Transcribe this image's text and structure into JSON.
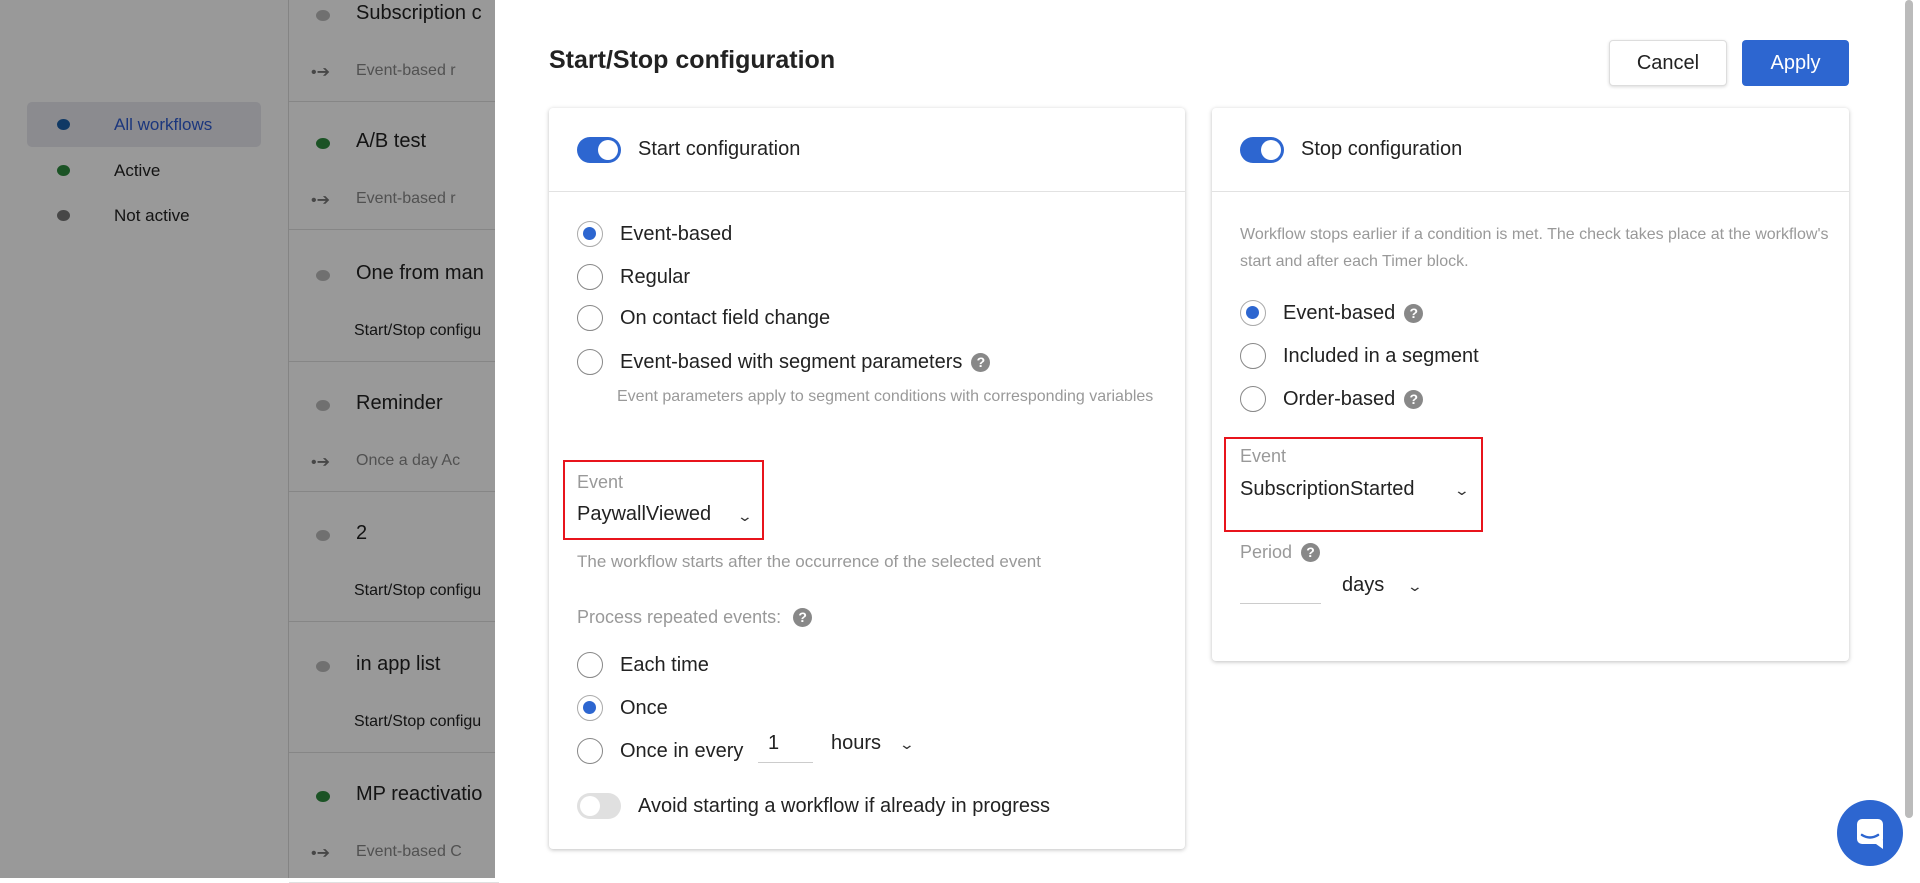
{
  "sidebar": {
    "items": [
      {
        "label": "All workflows",
        "color": "#1b5fa8",
        "selected": true
      },
      {
        "label": "Active",
        "color": "#2e8b3e"
      },
      {
        "label": "Not active",
        "color": "#777777"
      }
    ]
  },
  "workflows": [
    {
      "title": "Subscription c",
      "sub": "Event-based r",
      "trigger": true,
      "color": "#bbbbbb"
    },
    {
      "title": "A/B test",
      "sub": "Event-based r",
      "trigger": true,
      "color": "#2e8b3e"
    },
    {
      "title": "One from man",
      "sub": "Start/Stop configu",
      "trigger": false,
      "color": "#bbbbbb"
    },
    {
      "title": "Reminder",
      "sub": "Once a day  Ac",
      "trigger": true,
      "color": "#bbbbbb"
    },
    {
      "title": "2",
      "sub": "Start/Stop configu",
      "trigger": false,
      "color": "#bbbbbb"
    },
    {
      "title": "in app list",
      "sub": "Start/Stop configu",
      "trigger": false,
      "color": "#bbbbbb"
    },
    {
      "title": "MP reactivatio",
      "sub": "Event-based C",
      "trigger": true,
      "color": "#2e8b3e"
    }
  ],
  "modal": {
    "title": "Start/Stop configuration",
    "cancel": "Cancel",
    "apply": "Apply",
    "accent": "#2d66d0",
    "start": {
      "header": "Start configuration",
      "enabled": true,
      "options": [
        "Event-based",
        "Regular",
        "On contact field change",
        "Event-based with segment parameters"
      ],
      "selected": 0,
      "segment_help": "Event parameters apply to segment conditions with corresponding variables",
      "event_label": "Event",
      "event_value": "PaywallViewed",
      "event_hint": "The workflow starts after the occurrence of the selected event",
      "repeat_label": "Process repeated events:",
      "repeat_options": [
        "Each time",
        "Once",
        "Once in every"
      ],
      "repeat_selected": 1,
      "interval_value": "1",
      "interval_unit": "hours",
      "avoid_label": "Avoid starting a workflow if already in progress",
      "avoid_enabled": false
    },
    "stop": {
      "header": "Stop configuration",
      "enabled": true,
      "description": "Workflow stops earlier if a condition is met. The check takes place at the workflow's start and after each Timer block.",
      "options": [
        "Event-based",
        "Included in a segment",
        "Order-based"
      ],
      "selected": 0,
      "event_label": "Event",
      "event_value": "SubscriptionStarted",
      "period_label": "Period",
      "period_value": "",
      "period_unit": "days"
    }
  },
  "chat": {
    "icon": "chat-icon"
  }
}
